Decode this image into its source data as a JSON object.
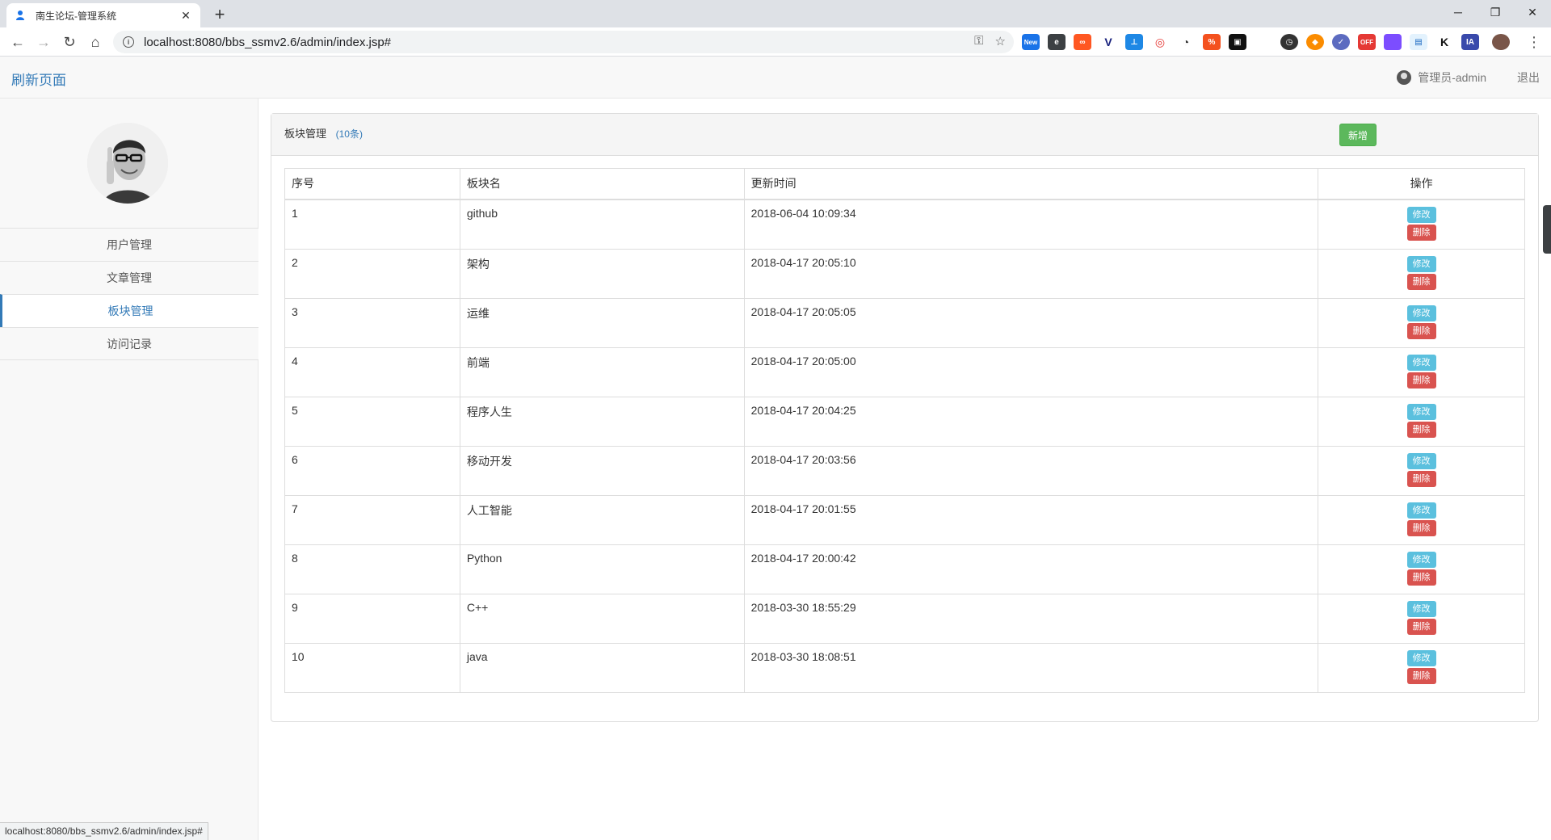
{
  "browser": {
    "tab_title": "南生论坛-管理系统",
    "tab_close": "✕",
    "new_tab": "+",
    "url": "localhost:8080/bbs_ssmv2.6/admin/index.jsp#",
    "status_url": "localhost:8080/bbs_ssmv2.6/admin/index.jsp#",
    "ext_new_badge": "New",
    "ext_off_badge": "OFF",
    "ext_k": "K",
    "ext_ia": "IA"
  },
  "header": {
    "brand": "刷新页面",
    "user_label": "管理员-admin",
    "logout_label": "退出"
  },
  "sidebar": {
    "items": [
      {
        "label": "用户管理"
      },
      {
        "label": "文章管理"
      },
      {
        "label": "板块管理"
      },
      {
        "label": "访问记录"
      }
    ]
  },
  "panel": {
    "title": "板块管理",
    "count": "(10条)",
    "add_label": "新增"
  },
  "table": {
    "headers": {
      "index": "序号",
      "name": "板块名",
      "updated": "更新时间",
      "ops": "操作"
    },
    "edit_label": "修改",
    "delete_label": "删除",
    "rows": [
      {
        "index": "1",
        "name": "github",
        "updated": "2018-06-04 10:09:34"
      },
      {
        "index": "2",
        "name": "架构",
        "updated": "2018-04-17 20:05:10"
      },
      {
        "index": "3",
        "name": "运维",
        "updated": "2018-04-17 20:05:05"
      },
      {
        "index": "4",
        "name": "前端",
        "updated": "2018-04-17 20:05:00"
      },
      {
        "index": "5",
        "name": "程序人生",
        "updated": "2018-04-17 20:04:25"
      },
      {
        "index": "6",
        "name": "移动开发",
        "updated": "2018-04-17 20:03:56"
      },
      {
        "index": "7",
        "name": "人工智能",
        "updated": "2018-04-17 20:01:55"
      },
      {
        "index": "8",
        "name": "Python",
        "updated": "2018-04-17 20:00:42"
      },
      {
        "index": "9",
        "name": "C++",
        "updated": "2018-03-30 18:55:29"
      },
      {
        "index": "10",
        "name": "java",
        "updated": "2018-03-30 18:08:51"
      }
    ]
  }
}
